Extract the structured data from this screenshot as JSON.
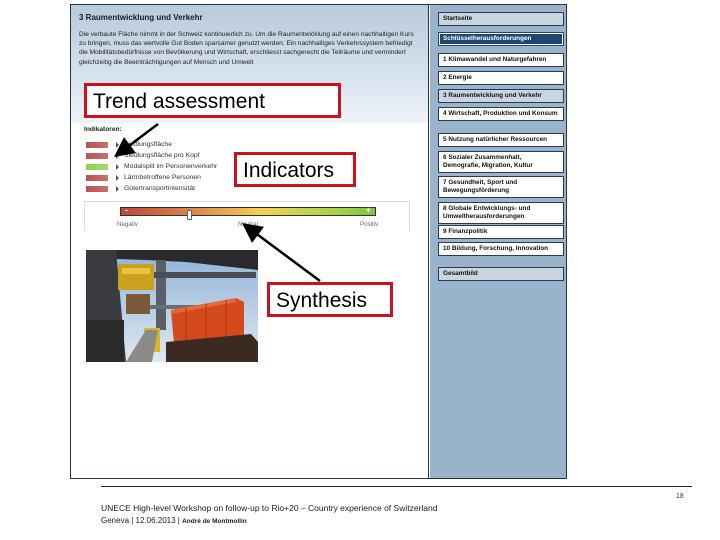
{
  "content": {
    "section_title": "3 Raumentwicklung und Verkehr",
    "intro": "Die verbaute Fläche nimmt in der Schweiz kontinuierlich zu. Um die Raumentwicklung auf einen nachhaltigen Kurs zu bringen, muss das wertvolle Gut Boden sparsamer genutzt werden. Ein nachhaltiges Verkehrssystem befriedigt die Mobilitätsbedürfnisse von Bevölkerung und Wirtschaft, erschliesst sachgerecht die Teilräume und vermindert gleichzeitig die Beeinträchtigungen auf Mensch und Umwelt",
    "indicators_title": "Indikatoren:",
    "indicators": [
      {
        "label": "Siedlungsfläche",
        "status": "negative",
        "color": "#b8524c"
      },
      {
        "label": "Siedlungsfläche pro Kopf",
        "status": "negative",
        "color": "#b8524c"
      },
      {
        "label": "Modalsplit im Personenverkehr",
        "status": "positive",
        "color": "#8fcf52"
      },
      {
        "label": "Lärmbetroffene Personen",
        "status": "negative",
        "color": "#b8524c"
      },
      {
        "label": "Gütertransportintensität",
        "status": "negative",
        "color": "#b8524c"
      }
    ],
    "scale": {
      "minus": "-",
      "plus": "+",
      "negative_label": "Negativ",
      "neutral_label": "Neutral",
      "positive_label": "Positiv",
      "synthesis_position": 0.27
    },
    "photo_alt": "Container cranes loading freight train"
  },
  "nav": {
    "items": [
      {
        "label": "Startseite",
        "style": "grey"
      },
      {
        "label": "Schlüsselherausforderungen",
        "style": "active"
      },
      {
        "label": "1 Klimawandel und Naturgefahren",
        "style": "white"
      },
      {
        "label": "2 Energie",
        "style": "white"
      },
      {
        "label": "3 Raumentwicklung und Verkehr",
        "style": "grey"
      },
      {
        "label": "4 Wirtschaft, Produktion und Konsum",
        "style": "white"
      },
      {
        "label": "5 Nutzung natürlicher Ressourcen",
        "style": "white"
      },
      {
        "label": "6 Sozialer Zusammenhalt, Demografie, Migration, Kultur",
        "style": "white"
      },
      {
        "label": "7 Gesundheit, Sport und Bewegungsförderung",
        "style": "white"
      },
      {
        "label": "8 Globale Entwicklungs- und Umweltherausforderungen",
        "style": "white"
      },
      {
        "label": "9 Finanzpolitik",
        "style": "white"
      },
      {
        "label": "10 Bildung, Forschung, Innovation",
        "style": "white"
      },
      {
        "label": "Gesamtbild",
        "style": "grey"
      }
    ]
  },
  "annotations": {
    "trend": "Trend assessment",
    "indicators": "Indicators",
    "synthesis": "Synthesis"
  },
  "footer": {
    "page_number": "18",
    "line1": "UNECE High-level Workshop on follow-up to Rio+20 – Country experience of Switzerland",
    "line2_prefix": "Geneva | 12.06.2013 | ",
    "author": "André de Montmollin"
  },
  "colors": {
    "annotation_border": "#cc1020",
    "nav_background": "#9ab3cc",
    "nav_active": "#1f4775"
  }
}
